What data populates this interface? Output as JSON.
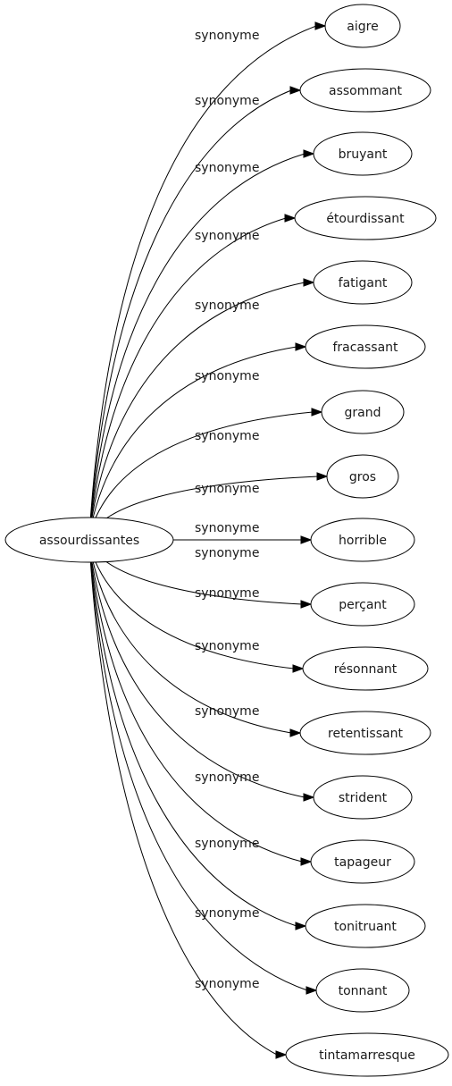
{
  "graph": {
    "source": {
      "id": "assourdissantes",
      "label": "assourdissantes"
    },
    "edge_label": "synonyme",
    "targets": [
      {
        "label": "aigre"
      },
      {
        "label": "assommant"
      },
      {
        "label": "bruyant"
      },
      {
        "label": "étourdissant"
      },
      {
        "label": "fatigant"
      },
      {
        "label": "fracassant"
      },
      {
        "label": "grand"
      },
      {
        "label": "gros"
      },
      {
        "label": "horrible"
      },
      {
        "label": "perçant"
      },
      {
        "label": "résonnant"
      },
      {
        "label": "retentissant"
      },
      {
        "label": "strident"
      },
      {
        "label": "tapageur"
      },
      {
        "label": "tonitruant"
      },
      {
        "label": "tonnant"
      },
      {
        "label": "tintamarresque"
      }
    ],
    "edges": [
      {
        "from": "assourdissantes",
        "to": "aigre",
        "label": "synonyme"
      },
      {
        "from": "assourdissantes",
        "to": "assommant",
        "label": "synonyme"
      },
      {
        "from": "assourdissantes",
        "to": "bruyant",
        "label": "synonyme"
      },
      {
        "from": "assourdissantes",
        "to": "étourdissant",
        "label": "synonyme"
      },
      {
        "from": "assourdissantes",
        "to": "fatigant",
        "label": "synonyme"
      },
      {
        "from": "assourdissantes",
        "to": "fracassant",
        "label": "synonyme"
      },
      {
        "from": "assourdissantes",
        "to": "grand",
        "label": "synonyme"
      },
      {
        "from": "assourdissantes",
        "to": "gros",
        "label": "synonyme"
      },
      {
        "from": "assourdissantes",
        "to": "horrible",
        "label": "synonyme"
      },
      {
        "from": "assourdissantes",
        "to": "perçant",
        "label": "synonyme"
      },
      {
        "from": "assourdissantes",
        "to": "résonnant",
        "label": "synonyme"
      },
      {
        "from": "assourdissantes",
        "to": "retentissant",
        "label": "synonyme"
      },
      {
        "from": "assourdissantes",
        "to": "strident",
        "label": "synonyme"
      },
      {
        "from": "assourdissantes",
        "to": "tapageur",
        "label": "synonyme"
      },
      {
        "from": "assourdissantes",
        "to": "tonitruant",
        "label": "synonyme"
      },
      {
        "from": "assourdissantes",
        "to": "tonnant",
        "label": "synonyme"
      },
      {
        "from": "assourdissantes",
        "to": "tintamarresque",
        "label": "synonyme"
      }
    ]
  }
}
